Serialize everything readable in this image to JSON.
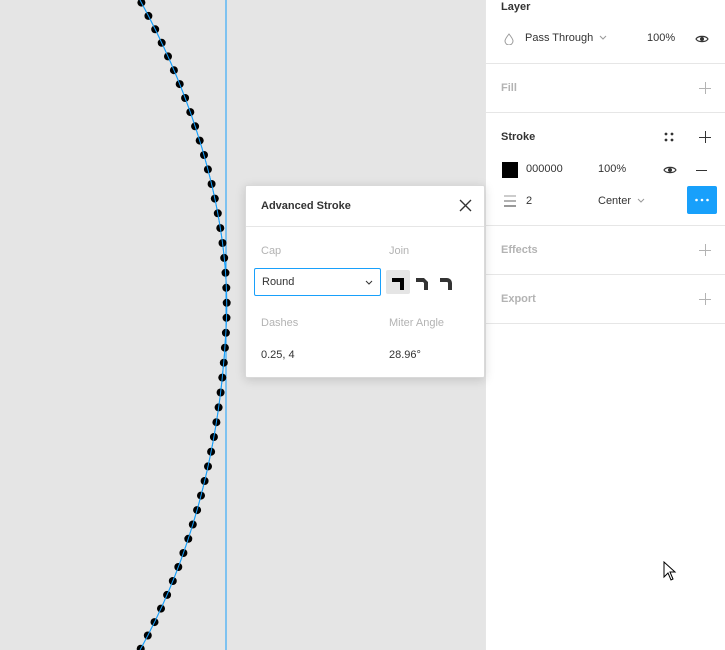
{
  "layer": {
    "title": "Layer",
    "blend_mode": "Pass Through",
    "opacity": "100%"
  },
  "fill": {
    "title": "Fill"
  },
  "stroke": {
    "title": "Stroke",
    "color_hex": "000000",
    "color_swatch": "#000000",
    "opacity": "100%",
    "weight": "2",
    "align": "Center"
  },
  "effects": {
    "title": "Effects"
  },
  "export": {
    "title": "Export"
  },
  "advanced_stroke": {
    "title": "Advanced Stroke",
    "cap_label": "Cap",
    "cap_value": "Round",
    "join_label": "Join",
    "dashes_label": "Dashes",
    "dashes_value": "0.25, 4",
    "miter_label": "Miter Angle",
    "miter_value": "28.96°"
  },
  "colors": {
    "accent": "#18a0fb",
    "canvas": "#e5e5e5",
    "panel": "#ffffff"
  }
}
